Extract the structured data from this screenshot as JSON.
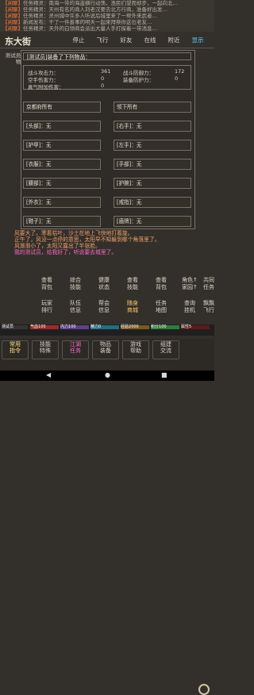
{
  "news": [
    {
      "tag": "【闲聊】",
      "text": "任务精灵：南海一带的海盗横行动荡，渔民们望而却步，一起向北…"
    },
    {
      "tag": "【闲聊】",
      "text": "任务精灵：天州有名的商人刘老汉要去北方行商，准备好出发…"
    },
    {
      "tag": "【闲聊】",
      "text": "任务精灵：灵州城中许多人听说后城里来了一帮外来武者…"
    },
    {
      "tag": "【闲聊】",
      "text": "新闻发布：干了一件善事的明天一起来拜祭你这位老友…"
    },
    {
      "tag": "【闲聊】",
      "text": "任务精灵：天外的白领商会派出大量人手打探着一带消息…"
    }
  ],
  "location": {
    "name": "东大街"
  },
  "actions": [
    {
      "label": "停止"
    },
    {
      "label": "飞行"
    },
    {
      "label": "好友"
    },
    {
      "label": "在线"
    },
    {
      "label": "附近"
    },
    {
      "label": "显示"
    }
  ],
  "npc": {
    "name": "测试员的宠物"
  },
  "panel": {
    "title": "[测试员]装备了下列物品：",
    "stats": [
      {
        "label": "战斗攻击力：",
        "value": "361",
        "label2": "战斗防御力：",
        "value2": "172"
      },
      {
        "label": "空手伤害力：",
        "value": "0",
        "label2": "装备防护力：",
        "value2": "0"
      },
      {
        "label": "真气附加伤害：",
        "value": "0",
        "label2": "",
        "value2": ""
      }
    ],
    "slots": [
      {
        "label": "京都府所有"
      },
      {
        "label": "领下所有"
      },
      {
        "label": "[头部]：无"
      },
      {
        "label": "[右手]：无"
      },
      {
        "label": "[护甲]：无"
      },
      {
        "label": "[左手]：无"
      },
      {
        "label": "[衣服]：无"
      },
      {
        "label": "[手部]：无"
      },
      {
        "label": "[腰部]：无"
      },
      {
        "label": "[护腕]：无"
      },
      {
        "label": "[外衣]：无"
      },
      {
        "label": "[戒指]：无"
      },
      {
        "label": "[鞋子]：无"
      },
      {
        "label": "[盾牌]：无"
      }
    ]
  },
  "story": [
    {
      "text": "风要大了。寒着枯叶，沙土在地上飞快地打着旋。"
    },
    {
      "text": "正午了，风没一点停的意思，太阳早不知躲到哪个角落里了。"
    },
    {
      "text": "风渐渐小了，太阳又露出了半张脸。"
    },
    {
      "text": "我的测试员，给我好了，听说要去城里了。",
      "pink": true
    }
  ],
  "commands": [
    {
      "l1": "查看",
      "l2": "背包"
    },
    {
      "l1": "综合",
      "l2": "技能"
    },
    {
      "l1": "健康",
      "l2": "状态"
    },
    {
      "l1": "查看",
      "l2": "技能"
    },
    {
      "l1": "查看",
      "l2": "背包"
    },
    {
      "l1": "角色↑",
      "l2": "家园↑"
    },
    {
      "l1": "共同",
      "l2": "任务"
    },
    {
      "l1": "玩家",
      "l2": "排行"
    },
    {
      "l1": "队伍",
      "l2": "信息"
    },
    {
      "l1": "帮会",
      "l2": "信息"
    },
    {
      "l1": "随身",
      "l2": "商城"
    },
    {
      "l1": "任务",
      "l2": "地图"
    },
    {
      "l1": "查询",
      "l2": "挂机"
    },
    {
      "l1": "飘飘",
      "l2": "飞行"
    }
  ],
  "status": [
    {
      "name": "测试员",
      "value": ""
    },
    {
      "name": "气血",
      "value": "100"
    },
    {
      "name": "内力",
      "value": "100"
    },
    {
      "name": "精力",
      "value": "0"
    },
    {
      "name": "经验",
      "value": "2000"
    },
    {
      "name": "积分",
      "value": "100"
    },
    {
      "name": "属性",
      "value": "5"
    }
  ],
  "bottom_tabs": [
    {
      "l1": "常用",
      "l2": "指令"
    },
    {
      "l1": "技能",
      "l2": "特殊"
    },
    {
      "l1": "江湖",
      "l2": "任务"
    },
    {
      "l1": "物品",
      "l2": "装备"
    },
    {
      "l1": "游戏",
      "l2": "帮助"
    },
    {
      "l1": "组建",
      "l2": "交流"
    }
  ],
  "android_nav": {
    "left": "◀",
    "center": "●",
    "right": "■"
  }
}
